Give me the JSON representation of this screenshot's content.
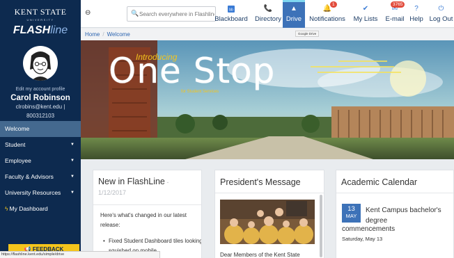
{
  "sidebar": {
    "logo_top": "KENT STATE",
    "logo_sub": "UNIVERSITY",
    "logo_flash": "FLASH",
    "logo_line": "line",
    "edit_profile": "Edit my account profile",
    "user_name": "Carol Robinson",
    "user_email": "clrobins@kent.edu |",
    "user_id": "800312103",
    "items": [
      {
        "label": "Welcome"
      },
      {
        "label": "Student"
      },
      {
        "label": "Employee"
      },
      {
        "label": "Faculty & Advisors"
      },
      {
        "label": "University Resources"
      },
      {
        "label": "My Dashboard"
      }
    ],
    "feedback": "FEEDBACK"
  },
  "topbar": {
    "search_placeholder": "Search everywhere in Flashline",
    "nav": [
      {
        "label": "Blackboard",
        "icon": "bb"
      },
      {
        "label": "Directory",
        "icon": "📞"
      },
      {
        "label": "Drive",
        "icon": "▲"
      },
      {
        "label": "Notifications",
        "icon": "🔔"
      },
      {
        "label": "My Lists",
        "icon": "✔"
      },
      {
        "label": "E-mail",
        "icon": "✉"
      },
      {
        "label": "Help",
        "icon": "?"
      },
      {
        "label": "Log Out",
        "icon": "⏻"
      }
    ],
    "notifications_badge": "1",
    "email_badge": "3765",
    "tooltip": "Google Drive"
  },
  "breadcrumb": {
    "home": "Home",
    "current": "Welcome"
  },
  "banner": {
    "intro": "Introducing",
    "main": "One Stop",
    "sub": "for Student Services"
  },
  "cards": {
    "new": {
      "title": "New in FlashLine",
      "sep": " - ",
      "date": "1/12/2017",
      "text": "Here's what's changed in our latest release:",
      "bullet": "Fixed Student Dashboard tiles looking squished on mobile"
    },
    "president": {
      "title": "President's Message",
      "text": "Dear Members of the Kent State"
    },
    "calendar": {
      "title": "Academic Calendar",
      "day": "13",
      "month": "MAY",
      "event_line1": "Kent Campus bachelor's degree",
      "event_line2": "commencements",
      "event_date": "Saturday, May 13"
    }
  },
  "statusbar": "https://flashline.kent.edu/simple/drive",
  "colors": {
    "sidebar": "#0d2a4f",
    "accent": "#3d72b8",
    "gold": "#f4c51c"
  }
}
